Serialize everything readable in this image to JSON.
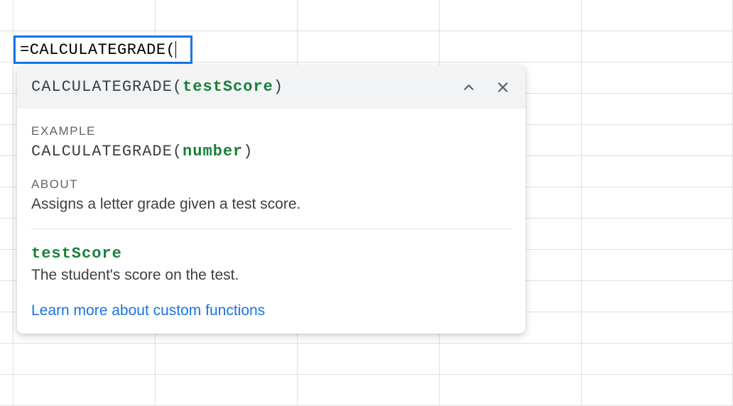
{
  "cell": {
    "formula": "=CALCULATEGRADE("
  },
  "tooltip": {
    "signature": {
      "funcName": "CALCULATEGRADE",
      "paramName": "testScore"
    },
    "example": {
      "label": "EXAMPLE",
      "funcName": "CALCULATEGRADE",
      "argType": "number"
    },
    "about": {
      "label": "ABOUT",
      "text": "Assigns a letter grade given a test score."
    },
    "param": {
      "name": "testScore",
      "description": "The student's score on the test."
    },
    "learnMore": "Learn more about custom functions"
  }
}
